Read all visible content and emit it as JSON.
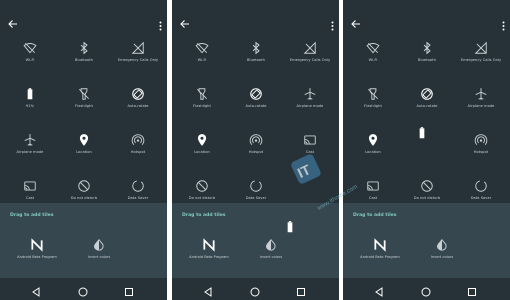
{
  "screens": [
    {
      "tiles": [
        {
          "icon": "wifi-off-icon",
          "label": "Wi-Fi"
        },
        {
          "icon": "bluetooth-icon",
          "label": "Bluetooth"
        },
        {
          "icon": "signal-icon",
          "label": "Emergency Calls Only"
        },
        {
          "icon": "battery-icon",
          "label": "91%"
        },
        {
          "icon": "flashlight-icon",
          "label": "Flashlight"
        },
        {
          "icon": "autorotate-icon",
          "label": "Auto-rotate"
        },
        {
          "icon": "airplane-icon",
          "label": "Airplane mode"
        },
        {
          "icon": "location-icon",
          "label": "Location"
        },
        {
          "icon": "hotspot-icon",
          "label": "Hotspot"
        },
        {
          "icon": "cast-icon",
          "label": "Cast"
        },
        {
          "icon": "do-not-disturb-icon",
          "label": "Do not disturb"
        },
        {
          "icon": "data-saver-icon",
          "label": "Data Saver"
        }
      ],
      "drag_title": "Drag to add tiles",
      "drag_tiles": [
        {
          "icon": "android-n-icon",
          "label": "Android Beta Program"
        },
        {
          "icon": "invert-colors-icon",
          "label": "Invert colors"
        }
      ]
    },
    {
      "tiles": [
        {
          "icon": "wifi-off-icon",
          "label": "Wi-Fi"
        },
        {
          "icon": "bluetooth-icon",
          "label": "Bluetooth"
        },
        {
          "icon": "signal-icon",
          "label": "Emergency Calls Only"
        },
        {
          "icon": "flashlight-icon",
          "label": "Flashlight"
        },
        {
          "icon": "autorotate-icon",
          "label": "Auto-rotate"
        },
        {
          "icon": "airplane-icon",
          "label": "Airplane mode"
        },
        {
          "icon": "location-icon",
          "label": "Location"
        },
        {
          "icon": "hotspot-icon",
          "label": "Hotspot"
        },
        {
          "icon": "cast-icon",
          "label": "Cast"
        },
        {
          "icon": "do-not-disturb-icon",
          "label": "Do not disturb"
        },
        {
          "icon": "data-saver-icon",
          "label": "Data Saver"
        },
        {
          "icon": "",
          "label": ""
        }
      ],
      "drag_title": "Drag to add tiles",
      "drag_tiles": [
        {
          "icon": "android-n-icon",
          "label": "Android Beta Program"
        },
        {
          "icon": "invert-colors-icon",
          "label": "Invert colors"
        }
      ]
    },
    {
      "tiles": [
        {
          "icon": "wifi-off-icon",
          "label": "Wi-Fi"
        },
        {
          "icon": "bluetooth-icon",
          "label": "Bluetooth"
        },
        {
          "icon": "signal-icon",
          "label": "Emergency Calls Only"
        },
        {
          "icon": "flashlight-icon",
          "label": "Flashlight"
        },
        {
          "icon": "autorotate-icon",
          "label": "Auto-rotate"
        },
        {
          "icon": "airplane-icon",
          "label": "Airplane mode"
        },
        {
          "icon": "location-icon",
          "label": "Location"
        },
        {
          "icon": "",
          "label": ""
        },
        {
          "icon": "hotspot-icon",
          "label": "Hotspot"
        },
        {
          "icon": "cast-icon",
          "label": "Cast"
        },
        {
          "icon": "do-not-disturb-icon",
          "label": "Do not disturb"
        },
        {
          "icon": "data-saver-icon",
          "label": "Data Saver"
        }
      ],
      "drag_title": "Drag to add tiles",
      "drag_tiles": [
        {
          "icon": "android-n-icon",
          "label": "Android Beta Program"
        },
        {
          "icon": "invert-colors-icon",
          "label": "Invert colors"
        }
      ]
    }
  ],
  "watermark": {
    "text": "www.ithome.com"
  },
  "colors": {
    "bg": "#263238",
    "drag_bg": "#37474f",
    "accent": "#80cbc4",
    "label": "#c8d0d4"
  }
}
